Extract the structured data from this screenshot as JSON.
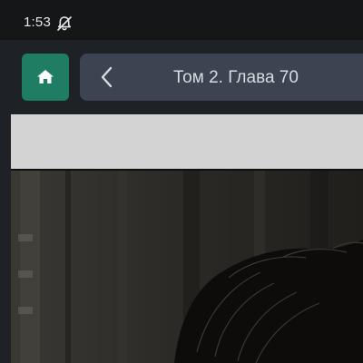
{
  "status_bar": {
    "time": "1:53",
    "notification_icon": "notifications-off-icon"
  },
  "nav": {
    "home_icon": "home-icon",
    "back_icon": "chevron-left-icon",
    "chapter_title": "Том 2. Глава 70"
  },
  "colors": {
    "home_button": "#1f7d63",
    "chapter_bar": "#3b4450",
    "background": "#1e2227",
    "status_bar": "#141618"
  },
  "reader": {
    "page_image": "manga-panel-image"
  }
}
